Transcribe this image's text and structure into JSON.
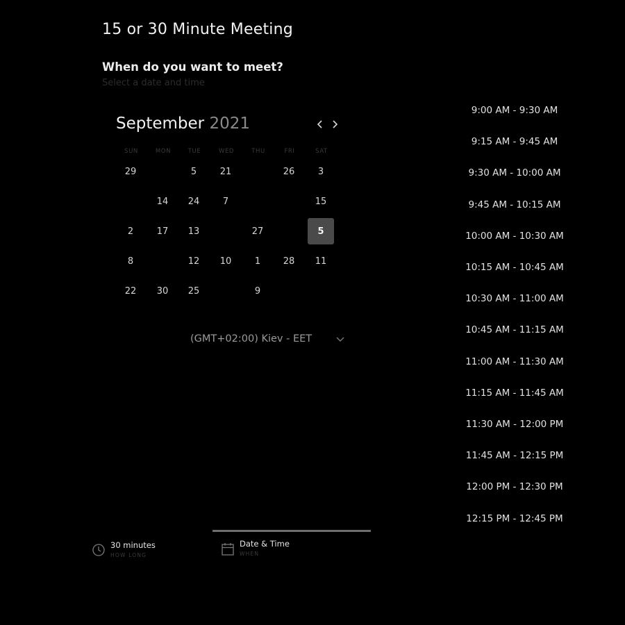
{
  "header": {
    "title": "15 or 30 Minute Meeting",
    "question": "When do you want to meet?",
    "instruction": "Select a date and time"
  },
  "calendar": {
    "month": "September",
    "year": "2021",
    "weekdays": [
      "SUN",
      "MON",
      "TUE",
      "WED",
      "THU",
      "FRI",
      "SAT"
    ],
    "rows": [
      [
        "29",
        "",
        "5",
        "21",
        "",
        "26",
        "3"
      ],
      [
        "",
        "14",
        "24",
        "7",
        "",
        "",
        "15"
      ],
      [
        "2",
        "17",
        "13",
        "",
        "27",
        "",
        "5"
      ],
      [
        "8",
        "",
        "12",
        "10",
        "1",
        "28",
        "11"
      ],
      [
        "22",
        "30",
        "25",
        "",
        "9",
        "",
        ""
      ]
    ],
    "selected": "5"
  },
  "timezone": {
    "label": "(GMT+02:00) Kiev - EET",
    "icon": "chevron-down-icon"
  },
  "time_slots": [
    "9:00 AM - 9:30 AM",
    "9:15 AM - 9:45 AM",
    "9:30 AM - 10:00 AM",
    "9:45 AM - 10:15 AM",
    "10:00 AM - 10:30 AM",
    "10:15 AM - 10:45 AM",
    "10:30 AM - 11:00 AM",
    "10:45 AM - 11:15 AM",
    "11:00 AM - 11:30 AM",
    "11:15 AM - 11:45 AM",
    "11:30 AM - 12:00 PM",
    "11:45 AM - 12:15 PM",
    "12:00 PM - 12:30 PM",
    "12:15 PM - 12:45 PM"
  ],
  "steps": [
    {
      "main": "30 minutes",
      "sub": "HOW LONG",
      "icon": "clock-icon"
    },
    {
      "main": "Date & Time",
      "sub": "WHEN",
      "icon": "calendar-icon"
    }
  ]
}
